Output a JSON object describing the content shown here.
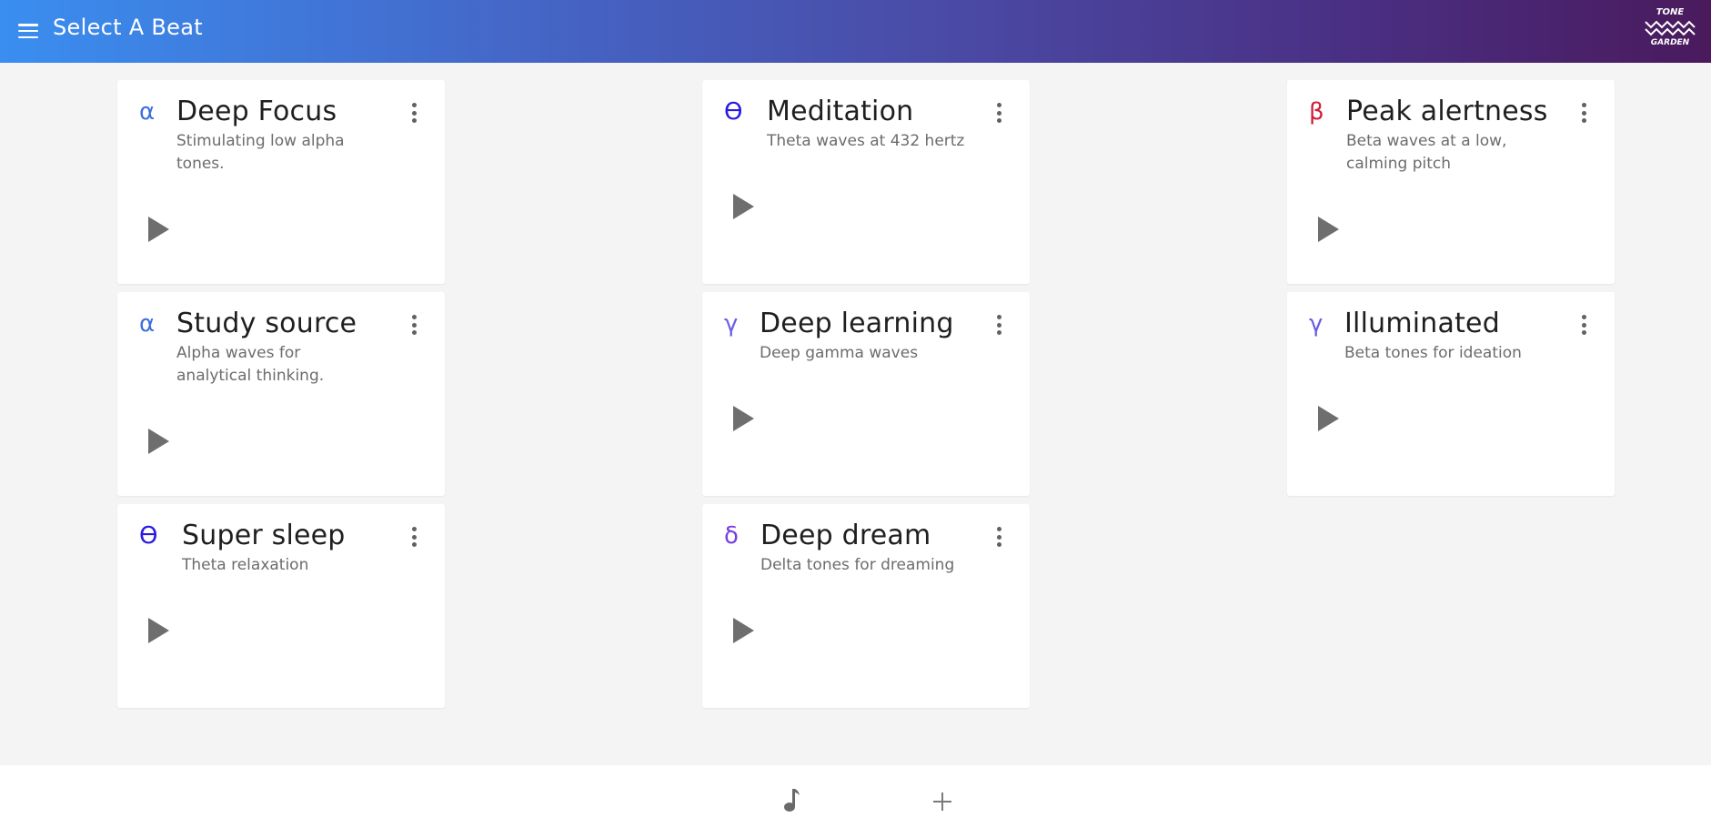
{
  "header": {
    "title": "Select A Beat",
    "logo_top": "TONE",
    "logo_bottom": "GARDEN",
    "menu_icon": "hamburger-menu-icon"
  },
  "beats": [
    {
      "symbol": "α",
      "symbol_color": "#3d6ee0",
      "title": "Deep Focus",
      "subtitle": "Stimulating low alpha tones."
    },
    {
      "symbol": "α",
      "symbol_color": "#3d6ee0",
      "title": "Study source",
      "subtitle": "Alpha waves for analytical thinking."
    },
    {
      "symbol": "ϴ",
      "symbol_color": "#2b1be0",
      "title": "Super sleep",
      "subtitle": "Theta relaxation"
    },
    {
      "symbol": "ϴ",
      "symbol_color": "#2b1be0",
      "title": "Meditation",
      "subtitle": "Theta waves at 432 hertz"
    },
    {
      "symbol": "γ",
      "symbol_color": "#6a5ce6",
      "title": "Deep learning",
      "subtitle": "Deep gamma waves"
    },
    {
      "symbol": "δ",
      "symbol_color": "#7a3ee0",
      "title": "Deep dream",
      "subtitle": "Delta tones for dreaming"
    },
    {
      "symbol": "β",
      "symbol_color": "#d0203a",
      "title": "Peak alertness",
      "subtitle": "Beta waves at a low, calming pitch"
    },
    {
      "symbol": "γ",
      "symbol_color": "#6a5ce6",
      "title": "Illuminated",
      "subtitle": "Beta tones for ideation"
    }
  ],
  "bottom_nav": {
    "items": [
      {
        "icon": "music-note-icon"
      },
      {
        "icon": "plus-icon"
      }
    ]
  }
}
